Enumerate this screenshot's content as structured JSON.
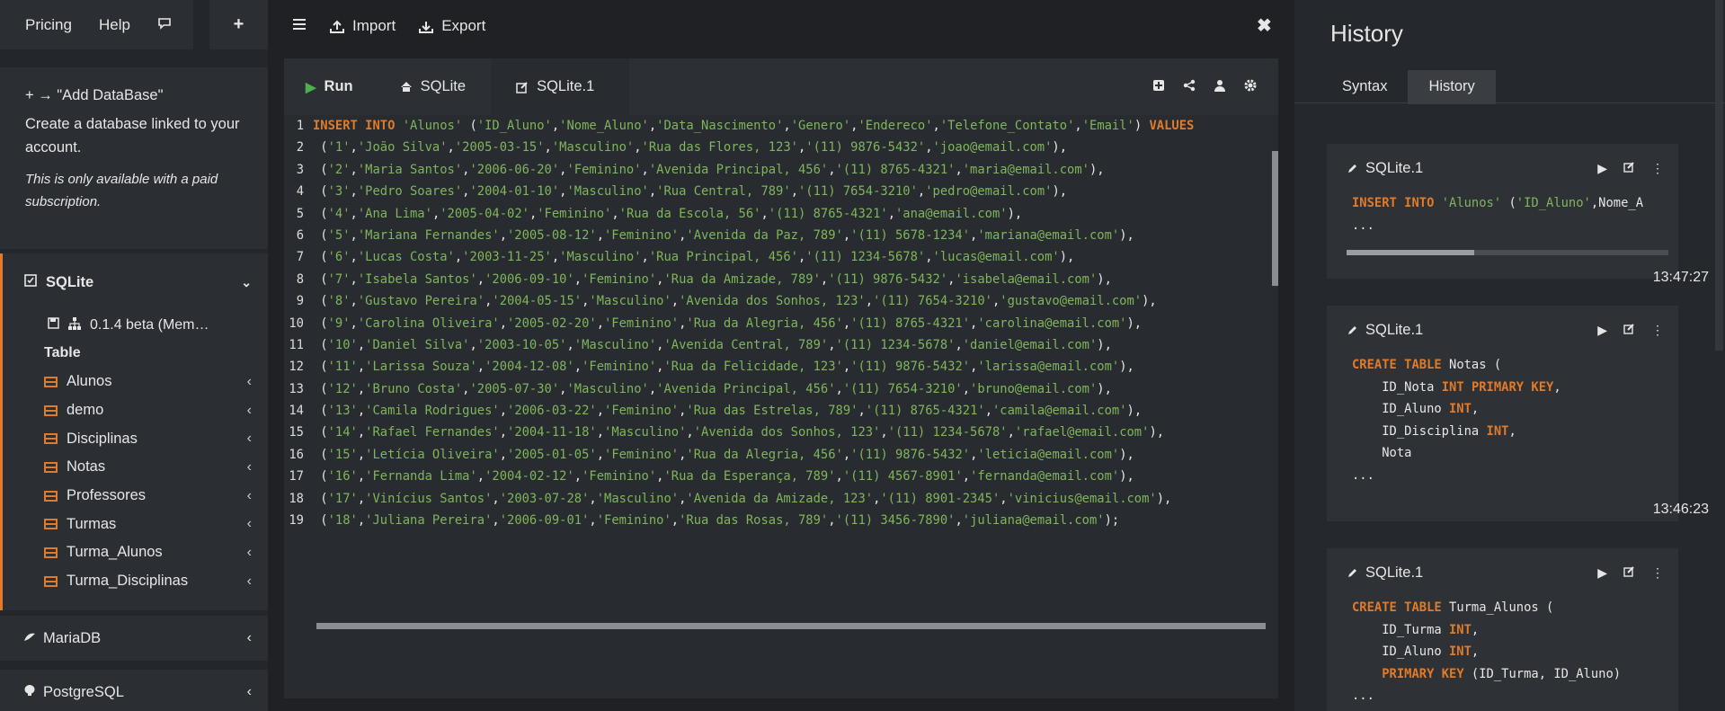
{
  "topnav": {
    "pricing": "Pricing",
    "help": "Help",
    "chat_icon": "chat-icon",
    "plus": "+"
  },
  "adddb": {
    "title": "+ → \"Add DataBase\"",
    "desc": "Create a database linked to your account.",
    "note": "This is only available with a paid subscription."
  },
  "sidebar": {
    "sqlite_label": "SQLite",
    "version": "0.1.4 beta (Mem…",
    "table_label": "Table",
    "tables": [
      "Alunos",
      "demo",
      "Disciplinas",
      "Notas",
      "Professores",
      "Turmas",
      "Turma_Alunos",
      "Turma_Disciplinas"
    ],
    "mariadb": "MariaDB",
    "postgres": "PostgreSQL"
  },
  "toolbar": {
    "import": "Import",
    "export": "Export"
  },
  "tabs": {
    "run": "Run",
    "sqlite": "SQLite",
    "sqlite1": "SQLite.1"
  },
  "code_lines": [
    "INSERT INTO 'Alunos' ('ID_Aluno','Nome_Aluno','Data_Nascimento','Genero','Endereco','Telefone_Contato','Email') VALUES",
    " ('1','João Silva','2005-03-15','Masculino','Rua das Flores, 123','(11) 9876-5432','joao@email.com'),",
    " ('2','Maria Santos','2006-06-20','Feminino','Avenida Principal, 456','(11) 8765-4321','maria@email.com'),",
    " ('3','Pedro Soares','2004-01-10','Masculino','Rua Central, 789','(11) 7654-3210','pedro@email.com'),",
    " ('4','Ana Lima','2005-04-02','Feminino','Rua da Escola, 56','(11) 8765-4321','ana@email.com'),",
    " ('5','Mariana Fernandes','2005-08-12','Feminino','Avenida da Paz, 789','(11) 5678-1234','mariana@email.com'),",
    " ('6','Lucas Costa','2003-11-25','Masculino','Rua Principal, 456','(11) 1234-5678','lucas@email.com'),",
    " ('7','Isabela Santos','2006-09-10','Feminino','Rua da Amizade, 789','(11) 9876-5432','isabela@email.com'),",
    " ('8','Gustavo Pereira','2004-05-15','Masculino','Avenida dos Sonhos, 123','(11) 7654-3210','gustavo@email.com'),",
    " ('9','Carolina Oliveira','2005-02-20','Feminino','Rua da Alegria, 456','(11) 8765-4321','carolina@email.com'),",
    " ('10','Daniel Silva','2003-10-05','Masculino','Avenida Central, 789','(11) 1234-5678','daniel@email.com'),",
    " ('11','Larissa Souza','2004-12-08','Feminino','Rua da Felicidade, 123','(11) 9876-5432','larissa@email.com'),",
    " ('12','Bruno Costa','2005-07-30','Masculino','Avenida Principal, 456','(11) 7654-3210','bruno@email.com'),",
    " ('13','Camila Rodrigues','2006-03-22','Feminino','Rua das Estrelas, 789','(11) 8765-4321','camila@email.com'),",
    " ('14','Rafael Fernandes','2004-11-18','Masculino','Avenida dos Sonhos, 123','(11) 1234-5678','rafael@email.com'),",
    " ('15','Letícia Oliveira','2005-01-05','Feminino','Rua da Alegria, 456','(11) 9876-5432','leticia@email.com'),",
    " ('16','Fernanda Lima','2004-02-12','Feminino','Rua da Esperança, 789','(11) 4567-8901','fernanda@email.com'),",
    " ('17','Vinícius Santos','2003-07-28','Masculino','Avenida da Amizade, 123','(11) 8901-2345','vinicius@email.com'),",
    " ('18','Juliana Pereira','2006-09-01','Feminino','Rua das Rosas, 789','(11) 3456-7890','juliana@email.com');"
  ],
  "history": {
    "title": "History",
    "tab_syntax": "Syntax",
    "tab_history": "History",
    "cards": [
      {
        "label": "SQLite.1",
        "time": "13:47:27",
        "lines": [
          "INSERT INTO 'Alunos' ('ID_Aluno','Nome_A",
          "..."
        ]
      },
      {
        "label": "SQLite.1",
        "time": "13:46:23",
        "lines": [
          "CREATE TABLE Notas (",
          "    ID_Nota INT PRIMARY KEY,",
          "    ID_Aluno INT,",
          "    ID_Disciplina INT,",
          "    Nota",
          "..."
        ]
      },
      {
        "label": "SQLite.1",
        "time": "",
        "lines": [
          "CREATE TABLE Turma_Alunos (",
          "    ID_Turma INT,",
          "    ID_Aluno INT,",
          "    PRIMARY KEY (ID_Turma, ID_Aluno)",
          "..."
        ]
      }
    ]
  },
  "colors": {
    "accent": "#e07b2a",
    "string": "#7fb55b",
    "run_green": "#4caf50"
  }
}
